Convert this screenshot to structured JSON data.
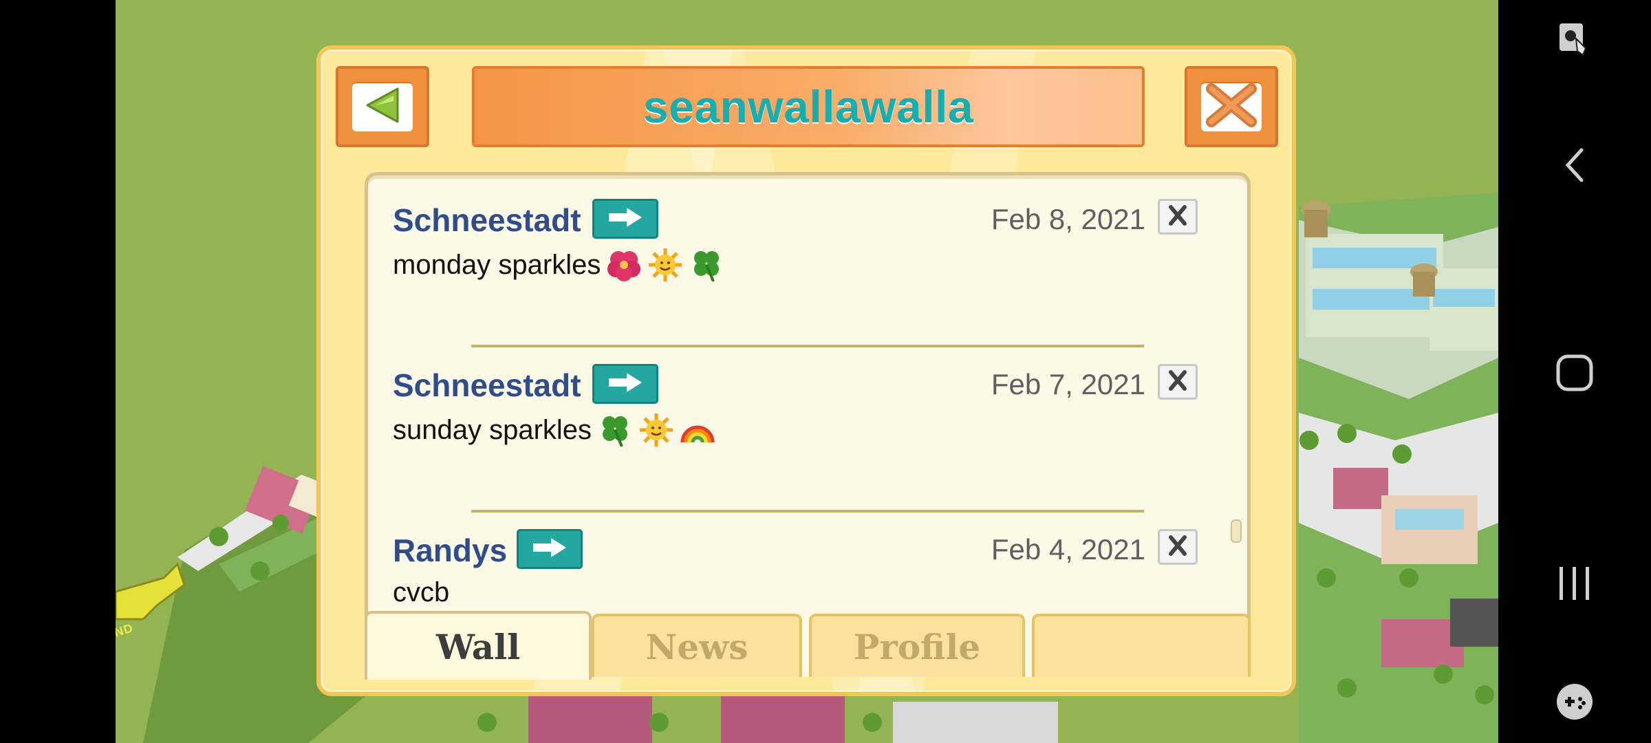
{
  "dialog": {
    "title": "seanwallawalla",
    "back_icon": "triangle-left-icon",
    "close_icon": "x-close-icon"
  },
  "posts": [
    {
      "author": "Schneestadt",
      "date": "Feb 8, 2021",
      "message": "monday sparkles",
      "emojis": [
        "hibiscus",
        "sun-face",
        "four-leaf-clover"
      ]
    },
    {
      "author": "Schneestadt",
      "date": "Feb 7, 2021",
      "message": "sunday sparkles",
      "emojis": [
        "four-leaf-clover",
        "sun-face",
        "rainbow"
      ]
    },
    {
      "author": "Randys",
      "date": "Feb 4, 2021",
      "message": "cvcb",
      "emojis": []
    }
  ],
  "tabs": [
    {
      "label": "Wall",
      "active": true
    },
    {
      "label": "News",
      "active": false
    },
    {
      "label": "Profile",
      "active": false
    },
    {
      "label": "",
      "active": false
    }
  ],
  "backdrop": {
    "sign_text": "ND"
  },
  "system_nav": [
    "screen-touch-icon",
    "back-chevron-icon",
    "home-icon",
    "recents-icon",
    "game-launcher-icon"
  ],
  "colors": {
    "title": "#17aeb0",
    "author": "#2f4d8b",
    "accent_orange": "#f0913e",
    "teal_button": "#24a7a1",
    "dialog_bg": "#fde999"
  }
}
